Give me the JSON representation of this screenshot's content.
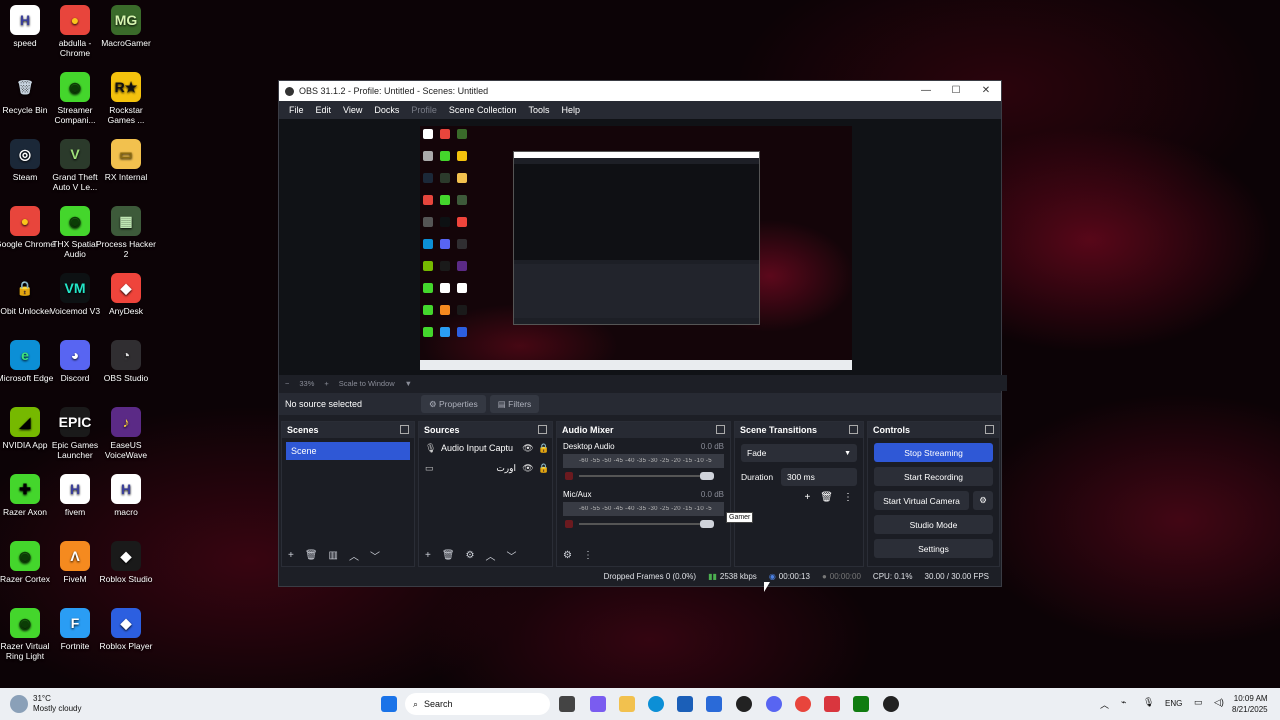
{
  "desktop": {
    "icons": [
      {
        "label": "speed",
        "glyph": "H",
        "color": "#ffffff",
        "fg": "#3b3f9a"
      },
      {
        "label": "abdulla - Chrome",
        "glyph": "●",
        "color": "#e8453c",
        "fg": "#f9c41c"
      },
      {
        "label": "MacroGamer",
        "glyph": "MG",
        "color": "#3a6b2a",
        "fg": "#d6f5b0"
      },
      {
        "label": "Recycle Bin",
        "glyph": "🗑",
        "color": "transparent",
        "fg": "#c8d4e0"
      },
      {
        "label": "Streamer Compani...",
        "glyph": "◉",
        "color": "#44d62c",
        "fg": "#0b3d05"
      },
      {
        "label": "Rockstar Games ...",
        "glyph": "R★",
        "color": "#f4c20d",
        "fg": "#111"
      },
      {
        "label": "Steam",
        "glyph": "◎",
        "color": "#1b2838",
        "fg": "#fff"
      },
      {
        "label": "Grand Theft Auto V Le...",
        "glyph": "V",
        "color": "#2b3a2b",
        "fg": "#9ee07a"
      },
      {
        "label": "RX Internal",
        "glyph": "▭",
        "color": "#f2c14e",
        "fg": "#8a6a10"
      },
      {
        "label": "Google Chrome",
        "glyph": "●",
        "color": "#e8453c",
        "fg": "#f9c41c"
      },
      {
        "label": "THX Spatial Audio",
        "glyph": "◉",
        "color": "#44d62c",
        "fg": "#0b3d05"
      },
      {
        "label": "Process Hacker 2",
        "glyph": "▦",
        "color": "#3d5a3a",
        "fg": "#bfe6b3"
      },
      {
        "label": "IObit Unlocker",
        "glyph": "🔒",
        "color": "transparent",
        "fg": "#fff"
      },
      {
        "label": "Voicemod V3",
        "glyph": "VM",
        "color": "#0d1113",
        "fg": "#23e6c8"
      },
      {
        "label": "AnyDesk",
        "glyph": "◆",
        "color": "#ef443b",
        "fg": "#fff"
      },
      {
        "label": "Microsoft Edge",
        "glyph": "e",
        "color": "#0c8fd6",
        "fg": "#3ee27d"
      },
      {
        "label": "Discord",
        "glyph": "◕",
        "color": "#5865f2",
        "fg": "#fff"
      },
      {
        "label": "OBS Studio",
        "glyph": "◔",
        "color": "#302e31",
        "fg": "#ddd"
      },
      {
        "label": "NVIDIA App",
        "glyph": "◢",
        "color": "#76b900",
        "fg": "#000"
      },
      {
        "label": "Epic Games Launcher",
        "glyph": "EPIC",
        "color": "#1a1a1a",
        "fg": "#fff"
      },
      {
        "label": "EaseUS VoiceWave",
        "glyph": "♪",
        "color": "#5b2a86",
        "fg": "#ffd23f"
      },
      {
        "label": "Razer Axon",
        "glyph": "✚",
        "color": "#44d62c",
        "fg": "#000"
      },
      {
        "label": "fivem",
        "glyph": "H",
        "color": "#ffffff",
        "fg": "#3b3f9a"
      },
      {
        "label": "macro",
        "glyph": "H",
        "color": "#ffffff",
        "fg": "#3b3f9a"
      },
      {
        "label": "Razer Cortex",
        "glyph": "◉",
        "color": "#44d62c",
        "fg": "#0b3d05"
      },
      {
        "label": "FiveM",
        "glyph": "Λ",
        "color": "#f58a1f",
        "fg": "#fff"
      },
      {
        "label": "Roblox Studio",
        "glyph": "◆",
        "color": "#1a1a1a",
        "fg": "#fff"
      },
      {
        "label": "Razer Virtual Ring Light",
        "glyph": "◉",
        "color": "#44d62c",
        "fg": "#0b3d05"
      },
      {
        "label": "Fortnite",
        "glyph": "F",
        "color": "#2a9df4",
        "fg": "#fff"
      },
      {
        "label": "Roblox Player",
        "glyph": "◆",
        "color": "#2c5fe0",
        "fg": "#fff"
      }
    ]
  },
  "obs": {
    "title": "OBS 31.1.2 - Profile: Untitled - Scenes: Untitled",
    "window_buttons": {
      "minimize": "—",
      "maximize": "☐",
      "close": "✕"
    },
    "menu": [
      {
        "label": "File",
        "disabled": false
      },
      {
        "label": "Edit",
        "disabled": false
      },
      {
        "label": "View",
        "disabled": false
      },
      {
        "label": "Docks",
        "disabled": false
      },
      {
        "label": "Profile",
        "disabled": true
      },
      {
        "label": "Scene Collection",
        "disabled": false
      },
      {
        "label": "Tools",
        "disabled": false
      },
      {
        "label": "Help",
        "disabled": false
      }
    ],
    "preview_bar": {
      "zoom_out": "−",
      "zoom": "33%",
      "zoom_in": "+",
      "scale": "Scale to Window",
      "dropdown": "▼"
    },
    "source_bar": {
      "status": "No source selected",
      "properties": "Properties",
      "filters": "Filters"
    },
    "scenes": {
      "title": "Scenes",
      "items": [
        "Scene"
      ]
    },
    "sources": {
      "title": "Sources",
      "items": [
        {
          "name": "Audio Input Captu",
          "icon": "🎙"
        },
        {
          "name": "ﺍﻭﺭﺕ",
          "icon": "▭"
        }
      ]
    },
    "mixer": {
      "title": "Audio Mixer",
      "channels": [
        {
          "name": "Desktop Audio",
          "db": "0.0 dB"
        },
        {
          "name": "Mic/Aux",
          "db": "0.0 dB"
        }
      ],
      "scale": "-60 -55 -50 -45 -40 -35 -30 -25 -20 -15 -10 -5 0"
    },
    "transitions": {
      "title": "Scene Transitions",
      "type": "Fade",
      "duration_label": "Duration",
      "duration": "300 ms"
    },
    "controls": {
      "title": "Controls",
      "buttons": [
        "Stop Streaming",
        "Start Recording",
        "Start Virtual Camera",
        "Studio Mode",
        "Settings"
      ]
    },
    "status": {
      "dropped": "Dropped Frames 0 (0.0%)",
      "bitrate": "2538 kbps",
      "stream_time": "00:00:13",
      "rec_time": "00:00:00",
      "cpu": "CPU: 0.1%",
      "fps": "30.00 / 30.00 FPS"
    },
    "tooltip": "Gamer"
  },
  "taskbar": {
    "weather_temp": "31°C",
    "weather_desc": "Mostly cloudy",
    "search_placeholder": "Search",
    "lang": "ENG",
    "time": "10:09 AM",
    "date": "8/21/2025"
  }
}
